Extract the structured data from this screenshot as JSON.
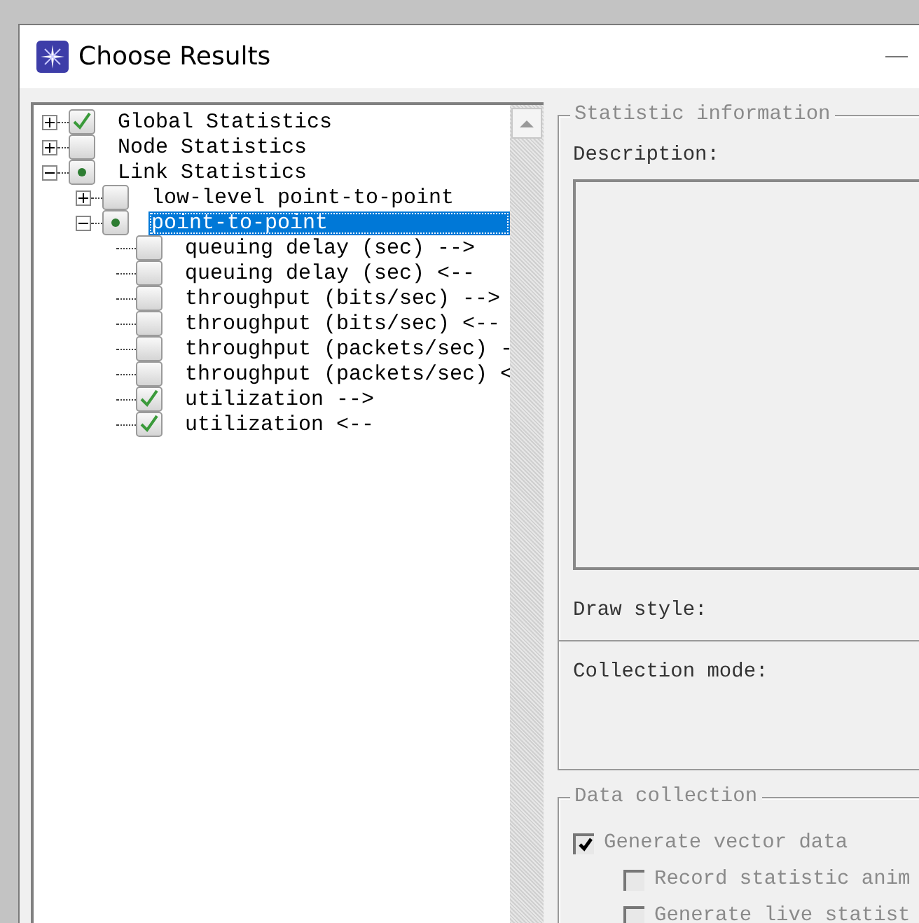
{
  "window": {
    "title": "Choose Results"
  },
  "tree": [
    {
      "label": "Global Statistics",
      "checked": true,
      "partial": false,
      "expanded": false,
      "selected": false
    },
    {
      "label": "Node Statistics",
      "checked": false,
      "partial": false,
      "expanded": false,
      "selected": false
    },
    {
      "label": "Link Statistics",
      "checked": false,
      "partial": true,
      "expanded": true,
      "selected": false,
      "children": [
        {
          "label": "low-level point-to-point",
          "checked": false,
          "partial": false,
          "expanded": false,
          "selected": false
        },
        {
          "label": "point-to-point",
          "checked": false,
          "partial": true,
          "expanded": true,
          "selected": true,
          "children": [
            {
              "label": "queuing delay (sec) -->",
              "checked": false,
              "selected": false
            },
            {
              "label": "queuing delay (sec) <--",
              "checked": false,
              "selected": false
            },
            {
              "label": "throughput (bits/sec) -->",
              "checked": false,
              "selected": false
            },
            {
              "label": "throughput (bits/sec) <--",
              "checked": false,
              "selected": false
            },
            {
              "label": "throughput (packets/sec) -",
              "checked": false,
              "selected": false
            },
            {
              "label": "throughput (packets/sec) <",
              "checked": false,
              "selected": false
            },
            {
              "label": "utilization -->",
              "checked": true,
              "selected": false
            },
            {
              "label": "utilization <--",
              "checked": true,
              "selected": false
            }
          ]
        }
      ]
    }
  ],
  "statistic_information": {
    "title": "Statistic information",
    "description_label": "Description:",
    "draw_style_label": "Draw style:",
    "collection_mode_label": "Collection mode:"
  },
  "data_collection": {
    "title": "Data collection",
    "options": [
      {
        "label": "Generate vector data",
        "checked": true,
        "disabled": true,
        "indented": false
      },
      {
        "label": "Record statistic anim",
        "checked": false,
        "disabled": true,
        "indented": true
      },
      {
        "label": "Generate live statist",
        "checked": false,
        "disabled": true,
        "indented": true
      }
    ]
  }
}
